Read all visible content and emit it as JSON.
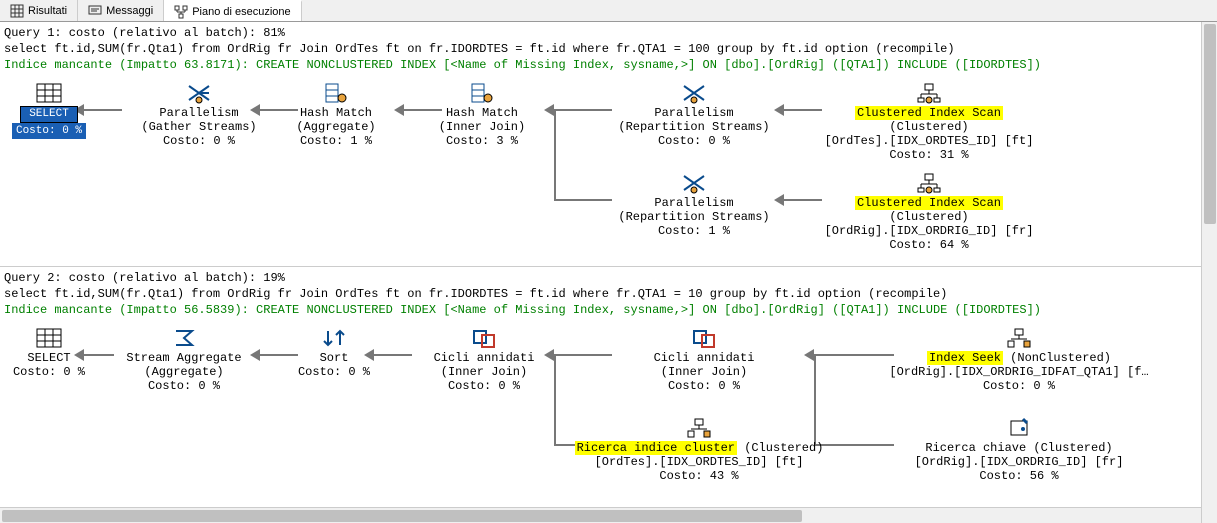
{
  "tabs": {
    "results": "Risultati",
    "messages": "Messaggi",
    "plan": "Piano di esecuzione"
  },
  "query1": {
    "title": "Query 1: costo (relativo al batch): 81%",
    "sql": "select ft.id,SUM(fr.Qta1) from OrdRig fr Join OrdTes ft on fr.IDORDTES = ft.id where fr.QTA1 = 100 group by ft.id option (recompile)",
    "missing": "Indice mancante (Impatto 63.8171): CREATE NONCLUSTERED INDEX [<Name of Missing Index, sysname,>] ON [dbo].[OrdRig] ([QTA1]) INCLUDE ([IDORDTES])",
    "ops": {
      "select": {
        "label": "SELECT",
        "cost": "Costo: 0 %"
      },
      "par_gather": {
        "l1": "Parallelism",
        "l2": "(Gather Streams)",
        "l3": "Costo: 0 %"
      },
      "hash_agg": {
        "l1": "Hash Match",
        "l2": "(Aggregate)",
        "l3": "Costo: 1 %"
      },
      "hash_join": {
        "l1": "Hash Match",
        "l2": "(Inner Join)",
        "l3": "Costo: 3 %"
      },
      "par_rep1": {
        "l1": "Parallelism",
        "l2": "(Repartition Streams)",
        "l3": "Costo: 0 %"
      },
      "cis_ft": {
        "hl": "Clustered Index Scan",
        "suffix": " (Clustered)",
        "l2": "[OrdTes].[IDX_ORDTES_ID] [ft]",
        "l3": "Costo: 31 %"
      },
      "par_rep2": {
        "l1": "Parallelism",
        "l2": "(Repartition Streams)",
        "l3": "Costo: 1 %"
      },
      "cis_fr": {
        "hl": "Clustered Index Scan",
        "suffix": " (Clustered)",
        "l2": "[OrdRig].[IDX_ORDRIG_ID] [fr]",
        "l3": "Costo: 64 %"
      }
    }
  },
  "query2": {
    "title": "Query 2: costo (relativo al batch): 19%",
    "sql": "select ft.id,SUM(fr.Qta1) from OrdRig fr Join OrdTes ft on fr.IDORDTES = ft.id where fr.QTA1 = 10 group by ft.id option (recompile)",
    "missing": "Indice mancante (Impatto 56.5839): CREATE NONCLUSTERED INDEX [<Name of Missing Index, sysname,>] ON [dbo].[OrdRig] ([QTA1]) INCLUDE ([IDORDTES])",
    "ops": {
      "select": {
        "label": "SELECT",
        "cost": "Costo: 0 %"
      },
      "stream_agg": {
        "l1": "Stream Aggregate",
        "l2": "(Aggregate)",
        "l3": "Costo: 0 %"
      },
      "sort": {
        "l1": "Sort",
        "l2": "Costo: 0 %"
      },
      "nl1": {
        "l1": "Cicli annidati",
        "l2": "(Inner Join)",
        "l3": "Costo: 0 %"
      },
      "nl2": {
        "l1": "Cicli annidati",
        "l2": "(Inner Join)",
        "l3": "Costo: 0 %"
      },
      "iseek": {
        "hl": "Index Seek",
        "suffix": " (NonClustered)",
        "l2": "[OrdRig].[IDX_ORDRIG_IDFAT_QTA1] [f…",
        "l3": "Costo: 0 %"
      },
      "cseek_ft": {
        "hl": "Ricerca indice cluster",
        "suffix": " (Clustered)",
        "l2": "[OrdTes].[IDX_ORDTES_ID] [ft]",
        "l3": "Costo: 43 %"
      },
      "keylookup": {
        "l1": "Ricerca chiave (Clustered)",
        "l2": "[OrdRig].[IDX_ORDRIG_ID] [fr]",
        "l3": "Costo: 56 %"
      }
    }
  }
}
